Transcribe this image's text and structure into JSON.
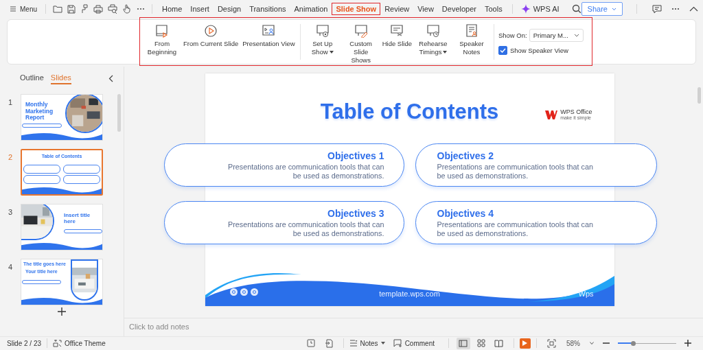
{
  "toolbar": {
    "menu_label": "Menu"
  },
  "tabs": [
    {
      "label": "Home",
      "selected": false
    },
    {
      "label": "Insert",
      "selected": false
    },
    {
      "label": "Design",
      "selected": false
    },
    {
      "label": "Transitions",
      "selected": false
    },
    {
      "label": "Animation",
      "selected": false
    },
    {
      "label": "Slide Show",
      "selected": true
    },
    {
      "label": "Review",
      "selected": false
    },
    {
      "label": "View",
      "selected": false
    },
    {
      "label": "Developer",
      "selected": false
    },
    {
      "label": "Tools",
      "selected": false
    }
  ],
  "ai_label": "WPS AI",
  "share_label": "Share",
  "ribbon": {
    "groups": [
      [
        {
          "label": "From Beginning",
          "kind": "tall",
          "has_menu": false
        },
        {
          "label": "From Current Slide",
          "kind": "wide",
          "has_menu": false
        },
        {
          "label": "Presentation View",
          "kind": "wide",
          "has_menu": false
        }
      ],
      [
        {
          "label": "Set Up Show",
          "kind": "tall",
          "has_menu": true
        },
        {
          "label": "Custom Slide Shows",
          "kind": "tall",
          "has_menu": false
        },
        {
          "label": "Hide Slide",
          "kind": "wide",
          "has_menu": false
        },
        {
          "label": "Rehearse Timings",
          "kind": "tall",
          "has_menu": true
        },
        {
          "label": "Speaker Notes",
          "kind": "tall",
          "has_menu": false
        }
      ]
    ],
    "show_on": {
      "label": "Show On:",
      "value": "Primary M..."
    },
    "speaker_view": {
      "label": "Show Speaker View",
      "checked": true
    }
  },
  "panel": {
    "tabs": [
      {
        "label": "Outline",
        "selected": false
      },
      {
        "label": "Slides",
        "selected": true
      }
    ],
    "slides": [
      {
        "number": "1",
        "selected": false,
        "kind": "cover",
        "title": "Monthly Marketing Report"
      },
      {
        "number": "2",
        "selected": true,
        "kind": "toc",
        "title": "Table of Contents"
      },
      {
        "number": "3",
        "selected": false,
        "kind": "title",
        "title": "Insert title here"
      },
      {
        "number": "4",
        "selected": false,
        "kind": "split",
        "title": "The title goes here",
        "subtitle": "Your title here"
      }
    ]
  },
  "slide": {
    "title": "Table of Contents",
    "logo_name": "WPS Office",
    "logo_tagline": "make it simple",
    "objectives": [
      {
        "title": "Objectives 1",
        "text": "Presentations are communication tools that can be used as demonstrations."
      },
      {
        "title": "Objectives 2",
        "text": "Presentations are communication tools that can be used as demonstrations."
      },
      {
        "title": "Objectives 3",
        "text": "Presentations are communication tools that can be used as demonstrations."
      },
      {
        "title": "Objectives 4",
        "text": "Presentations are communication tools that can be used as demonstrations."
      }
    ],
    "footer_url": "template.wps.com",
    "footer_brand": "Wps"
  },
  "notes_placeholder": "Click to add notes",
  "status": {
    "slide_label": "Slide 2 / 23",
    "theme": "Office Theme",
    "notes": "Notes",
    "comment": "Comment",
    "views": [
      {
        "selected": true
      },
      {
        "selected": false
      },
      {
        "selected": false
      }
    ],
    "zoom": "58%",
    "zoom_slider": {
      "level": 0.27
    }
  }
}
